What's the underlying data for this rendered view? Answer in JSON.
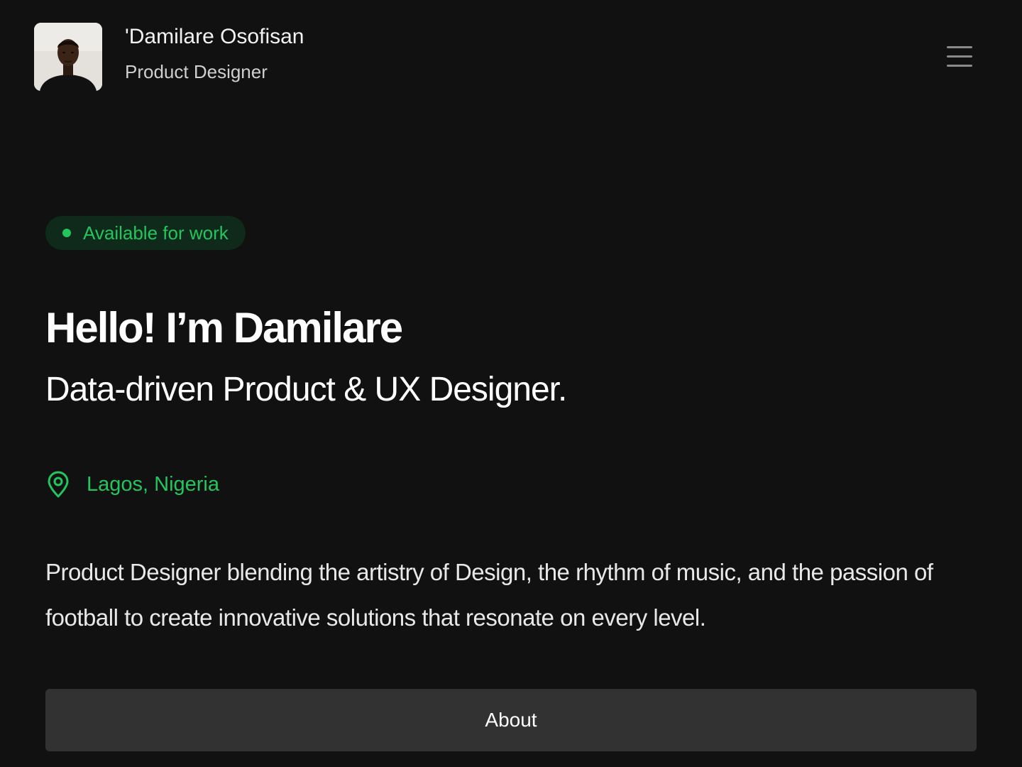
{
  "header": {
    "owner_name": "'Damilare Osofisan",
    "owner_role": "Product Designer",
    "avatar_icon": "profile-photo",
    "menu_icon": "hamburger-menu-icon"
  },
  "hero": {
    "status_label": "Available for work",
    "greeting": "Hello! I’m Damilare",
    "tagline": "Data-driven Product & UX Designer.",
    "location": "Lagos, Nigeria",
    "location_icon": "map-pin-icon",
    "bio": "Product Designer blending  the artistry of Design, the rhythm of music, and the passion of football to create innovative solutions that resonate on every level."
  },
  "actions": {
    "about_label": "About"
  },
  "colors": {
    "background": "#111111",
    "accent_green": "#22c55e",
    "pill_background": "#0f2a1a",
    "button_background": "#323232"
  }
}
